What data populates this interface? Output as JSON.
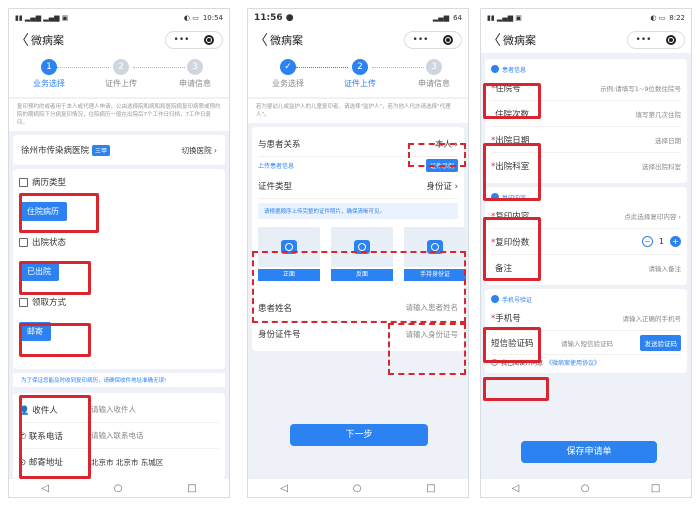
{
  "common": {
    "title": "微病案",
    "back": "〈",
    "more": "•••",
    "steps": [
      "业务选择",
      "证件上传",
      "申请信息"
    ],
    "nav": [
      "◁",
      "○",
      "□"
    ]
  },
  "p1": {
    "time": "10:54",
    "notice": "复印预约的或者用于本人或代理人申请，公由选择院和病和和医院病复印病质或预约院的期病院下分病复印情况，住院病历一般在出院后7个工作日归档，7工作日复印。",
    "hospital": "徐州市传染病医院",
    "hospital_tag": "三甲",
    "switch": "切换医院",
    "case_type_label": "病历类型",
    "case_type_value": "住院病历",
    "discharge_label": "出院状态",
    "discharge_value": "已出院",
    "pickup_label": "领取方式",
    "pickup_value": "邮寄",
    "reminder": "为了保证您能及时收到复印病历，请确保收件地址准确无误!",
    "recipient_label": "收件人",
    "recipient_placeholder": "请输入收件人",
    "phone_label": "联系电话",
    "phone_placeholder": "请输入联系电话",
    "address_label": "邮寄地址",
    "address_value": "北京市 北京市 东城区"
  },
  "p2": {
    "time": "11:56",
    "battery": "64",
    "notice": "若为婴幼儿或监护人的儿童复印者，请选择\"监护人\"，若为他人代办请选择\"代理人\"。",
    "relation_label": "与患者关系",
    "relation_value": "本人",
    "upload_label": "上传患者信息",
    "example_btn": "证件示例",
    "id_type_label": "证件类型",
    "id_type_value": "身份证",
    "upload_hint": "请根据顺序上传完整的证件照片，确保清晰可见。",
    "cards": [
      "正面",
      "反面",
      "手持身份证"
    ],
    "name_label": "患者姓名",
    "name_placeholder": "请输入患者姓名",
    "idno_label": "身份证件号",
    "idno_placeholder": "请输入身份证号",
    "next": "下一步"
  },
  "p3": {
    "time": "8:22",
    "section1": "患者信息",
    "admission_no_label": "住院号",
    "admission_no_placeholder": "示例:请填写1~9位数住院号",
    "admission_count_label": "住院次数",
    "admission_count_placeholder": "填写第几次住院",
    "discharge_date_label": "出院日期",
    "discharge_date_placeholder": "选择日期",
    "dept_label": "出院科室",
    "dept_placeholder": "选择出院科室",
    "section2": "复印内容",
    "copy_content_label": "复印内容",
    "copy_content_placeholder": "点此选择复印内容",
    "copy_count_label": "复印份数",
    "copy_count_value": "1",
    "note_label": "备注",
    "note_placeholder": "请输入备注",
    "section3": "手机号验证",
    "mobile_label": "手机号",
    "mobile_placeholder": "请输入正确的手机号",
    "sms_label": "短信验证码",
    "sms_placeholder": "请输入短信验证码",
    "send_code": "发送验证码",
    "agree_text": "我已阅读并同意",
    "agreement": "《微病案使用协议》",
    "submit": "保存申请单"
  }
}
